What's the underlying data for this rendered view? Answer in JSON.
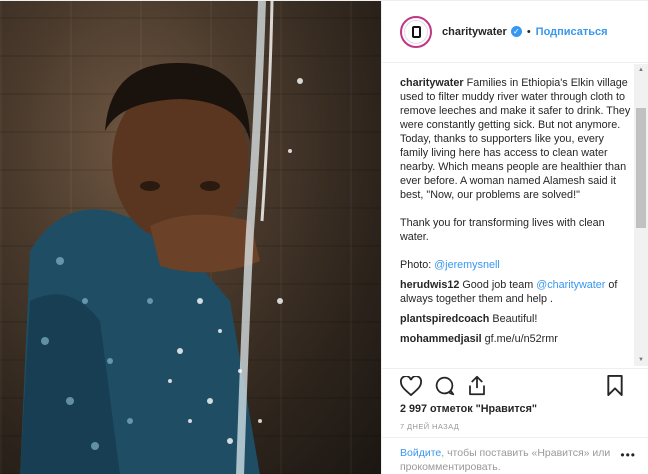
{
  "post": {
    "username": "charitywater",
    "follow_label": "Подписаться",
    "separator": "•",
    "caption_user": "charitywater",
    "caption_text": " Families in Ethiopia's Elkin village used to filter muddy river water through cloth to remove leeches and make it safer to drink. They were constantly getting sick. But not anymore. Today, thanks to supporters like you, every family living here has access to clean water nearby. Which means people are healthier than ever before. A woman named Alamesh said it best, \"Now, our problems are solved!\"\n\nThank you for transforming lives with clean water.\n\nPhoto: ",
    "caption_mention": "@jeremysnell",
    "comments": [
      {
        "user": "herudwis12",
        "pre": " Good job team ",
        "mention": "@charitywater",
        "post": " of always together them and help ."
      },
      {
        "user": "plantspiredcoach",
        "pre": " Beautiful!",
        "mention": "",
        "post": ""
      },
      {
        "user": "mohammedjasil",
        "pre": " gf.me/u/n52rmr",
        "mention": "",
        "post": ""
      }
    ],
    "likes": "2 997 отметок \"Нравится\"",
    "time": "7 ДНЕЙ НАЗАД",
    "login_link": "Войдите",
    "login_text": ", чтобы поставить «Нравится» или прокомментировать.",
    "more": "•••"
  },
  "icons": {
    "like": "heart-icon",
    "comment": "comment-icon",
    "share": "share-icon",
    "save": "bookmark-icon",
    "verified": "verified-badge-icon"
  },
  "colors": {
    "link": "#3897f0",
    "text": "#262626",
    "muted": "#999999"
  }
}
